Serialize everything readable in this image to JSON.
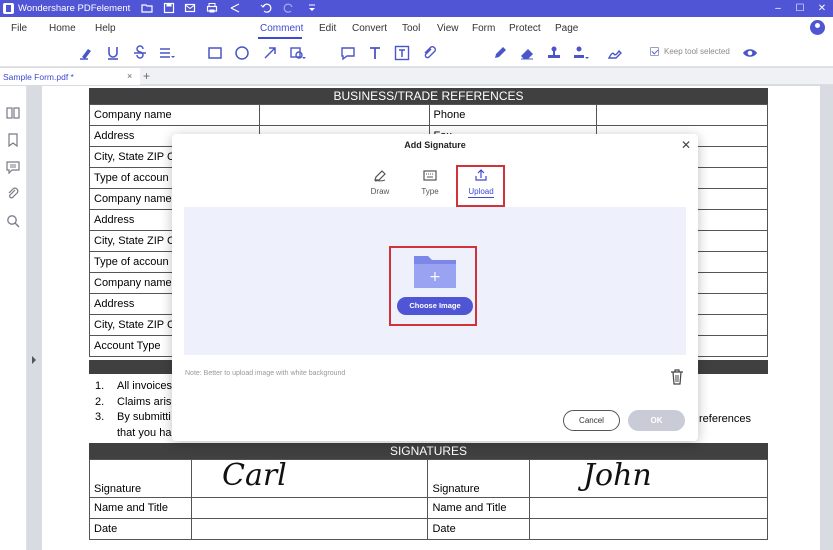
{
  "app": {
    "title": "Wondershare PDFelement"
  },
  "window_controls": [
    "–",
    "☐",
    "✕"
  ],
  "menu": {
    "items": [
      "File",
      "Home",
      "Help",
      "Comment",
      "Edit",
      "Convert",
      "Tool",
      "View",
      "Form",
      "Protect",
      "Page"
    ],
    "active": "Comment"
  },
  "toolbar": {
    "keep_tool_selected": "Keep tool selected"
  },
  "tabs": {
    "document": "Sample Form.pdf *",
    "close": "×",
    "add": "+"
  },
  "document": {
    "business_header": "BUSINESS/TRADE REFERENCES",
    "rows": [
      [
        "Company name",
        "",
        "Phone",
        ""
      ],
      [
        "Address",
        "",
        "Fax",
        ""
      ],
      [
        "City, State ZIP C",
        "",
        "",
        ""
      ],
      [
        "Type of accoun",
        "",
        "",
        ""
      ],
      [
        "Company name",
        "",
        "",
        ""
      ],
      [
        "Address",
        "",
        "",
        ""
      ],
      [
        "City, State ZIP C",
        "",
        "",
        ""
      ],
      [
        "Type of accoun",
        "",
        "",
        ""
      ],
      [
        "Company name",
        "",
        "",
        ""
      ],
      [
        "Address",
        "",
        "",
        ""
      ],
      [
        "City, State ZIP C",
        "",
        "",
        ""
      ],
      [
        "Account Type",
        "",
        "",
        ""
      ]
    ],
    "list": [
      {
        "n": "1.",
        "text": "All invoices"
      },
      {
        "n": "2.",
        "text": "Claims aris"
      },
      {
        "n": "3.",
        "text": "By submitti"
      }
    ],
    "list_cont": "that you ha",
    "references_tail": "references",
    "signatures_header": "SIGNATURES",
    "sig_rows": [
      [
        "Signature",
        "",
        "Signature",
        ""
      ],
      [
        "Name and Title",
        "",
        "Name and Title",
        ""
      ],
      [
        "Date",
        "",
        "Date",
        ""
      ]
    ],
    "signature_left": "Carl",
    "signature_right": "John"
  },
  "dialog": {
    "title": "Add Signature",
    "tabs": [
      {
        "label": "Draw",
        "icon": "pen-icon"
      },
      {
        "label": "Type",
        "icon": "keyboard-icon"
      },
      {
        "label": "Upload",
        "icon": "upload-icon"
      }
    ],
    "active_tab": "Upload",
    "choose_image": "Choose Image",
    "folder_plus": "+",
    "note": "Note: Better to upload image with white background",
    "cancel": "Cancel",
    "ok": "OK"
  },
  "colors": {
    "brand": "#4f55d4",
    "accent": "#3d4ad1",
    "highlight_box": "#d2333b",
    "upload_bg": "#eef0fb",
    "ok_disabled": "#c9cbd6"
  }
}
